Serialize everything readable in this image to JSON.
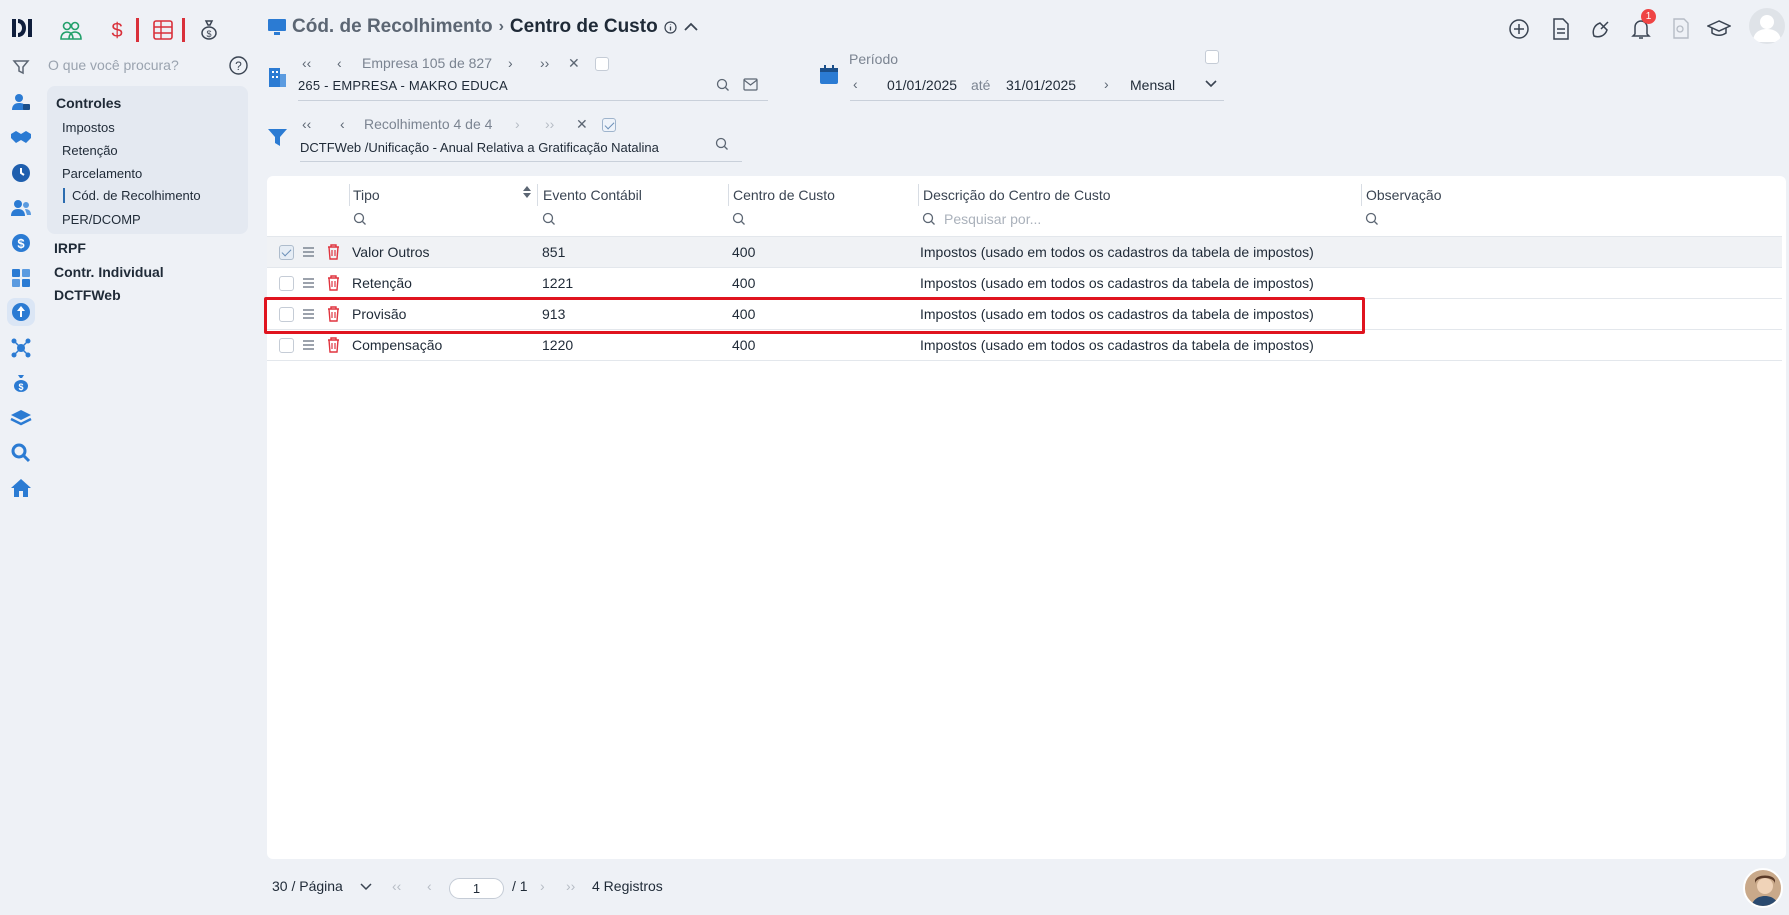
{
  "header": {
    "breadcrumb_parent": "Cód. de Recolhimento",
    "breadcrumb_current": "Centro de Custo",
    "notification_count": "1"
  },
  "sidebar": {
    "search_placeholder": "O que você procura?",
    "controls_title": "Controles",
    "controls_items": [
      "Impostos",
      "Retenção",
      "Parcelamento",
      "Cód. de Recolhimento",
      "PER/DCOMP"
    ],
    "main_items": [
      "IRPF",
      "Contr. Individual",
      "DCTFWeb"
    ]
  },
  "empresa": {
    "counter": "Empresa 105 de 827",
    "value": "265 - EMPRESA - MAKRO EDUCA"
  },
  "periodo": {
    "label": "Período",
    "start": "01/01/2025",
    "separator": "até",
    "end": "31/01/2025",
    "frequency": "Mensal"
  },
  "recolhimento": {
    "counter": "Recolhimento 4 de 4",
    "value": "DCTFWeb /Unificação - Anual Relativa a Gratificação Natalina"
  },
  "table": {
    "columns": [
      "Tipo",
      "Evento Contábil",
      "Centro de Custo",
      "Descrição do Centro de Custo",
      "Observação"
    ],
    "description_filter_placeholder": "Pesquisar por...",
    "rows": [
      {
        "tipo": "Valor Outros",
        "evento": "851",
        "centro": "400",
        "descricao": "Impostos (usado em todos os cadastros da tabela de impostos)",
        "observacao": "",
        "checked": true
      },
      {
        "tipo": "Retenção",
        "evento": "1221",
        "centro": "400",
        "descricao": "Impostos (usado em todos os cadastros da tabela de impostos)",
        "observacao": "",
        "checked": false
      },
      {
        "tipo": "Provisão",
        "evento": "913",
        "centro": "400",
        "descricao": "Impostos (usado em todos os cadastros da tabela de impostos)",
        "observacao": "",
        "checked": false
      },
      {
        "tipo": "Compensação",
        "evento": "1220",
        "centro": "400",
        "descricao": "Impostos (usado em todos os cadastros da tabela de impostos)",
        "observacao": "",
        "checked": false
      }
    ]
  },
  "pagination": {
    "page_size": "30 / Página",
    "current_page": "1",
    "total_pages": "/ 1",
    "records": "4 Registros"
  },
  "colors": {
    "accent": "#2b6cb0",
    "danger": "#e0141f",
    "brand_dark": "#0f1e3c"
  }
}
